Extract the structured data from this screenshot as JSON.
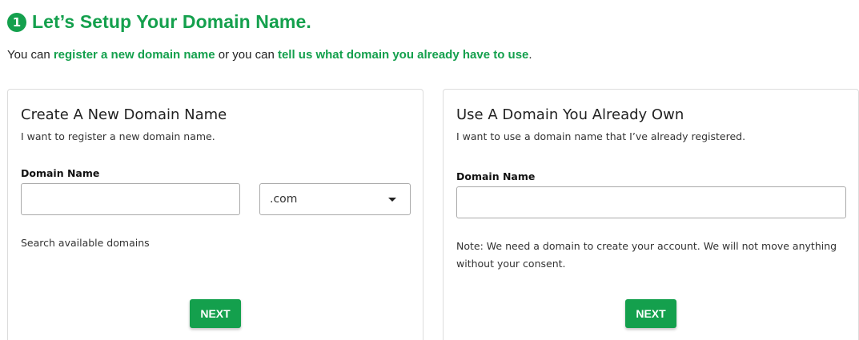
{
  "header": {
    "step_number": "1",
    "title": "Let’s Setup Your Domain Name."
  },
  "intro": {
    "text_1": "You can ",
    "link_register": "register a new domain name",
    "text_2": " or you can ",
    "link_existing": "tell us what domain you already have to use",
    "text_3": "."
  },
  "new_domain": {
    "title": "Create A New Domain Name",
    "subtitle": "I want to register a new domain name.",
    "field_label": "Domain Name",
    "input_value": "",
    "tld_selected": ".com",
    "helper": "Search available domains",
    "button": "NEXT"
  },
  "existing_domain": {
    "title": "Use A Domain You Already Own",
    "subtitle": "I want to use a domain name that I’ve already registered.",
    "field_label": "Domain Name",
    "input_value": "",
    "note_line1": "Note: We need a domain to create your account. We will not move anything",
    "note_line2": "without your consent.",
    "button": "NEXT"
  },
  "colors": {
    "accent": "#14a04d",
    "border": "#dcdcdc",
    "text": "#222222"
  }
}
